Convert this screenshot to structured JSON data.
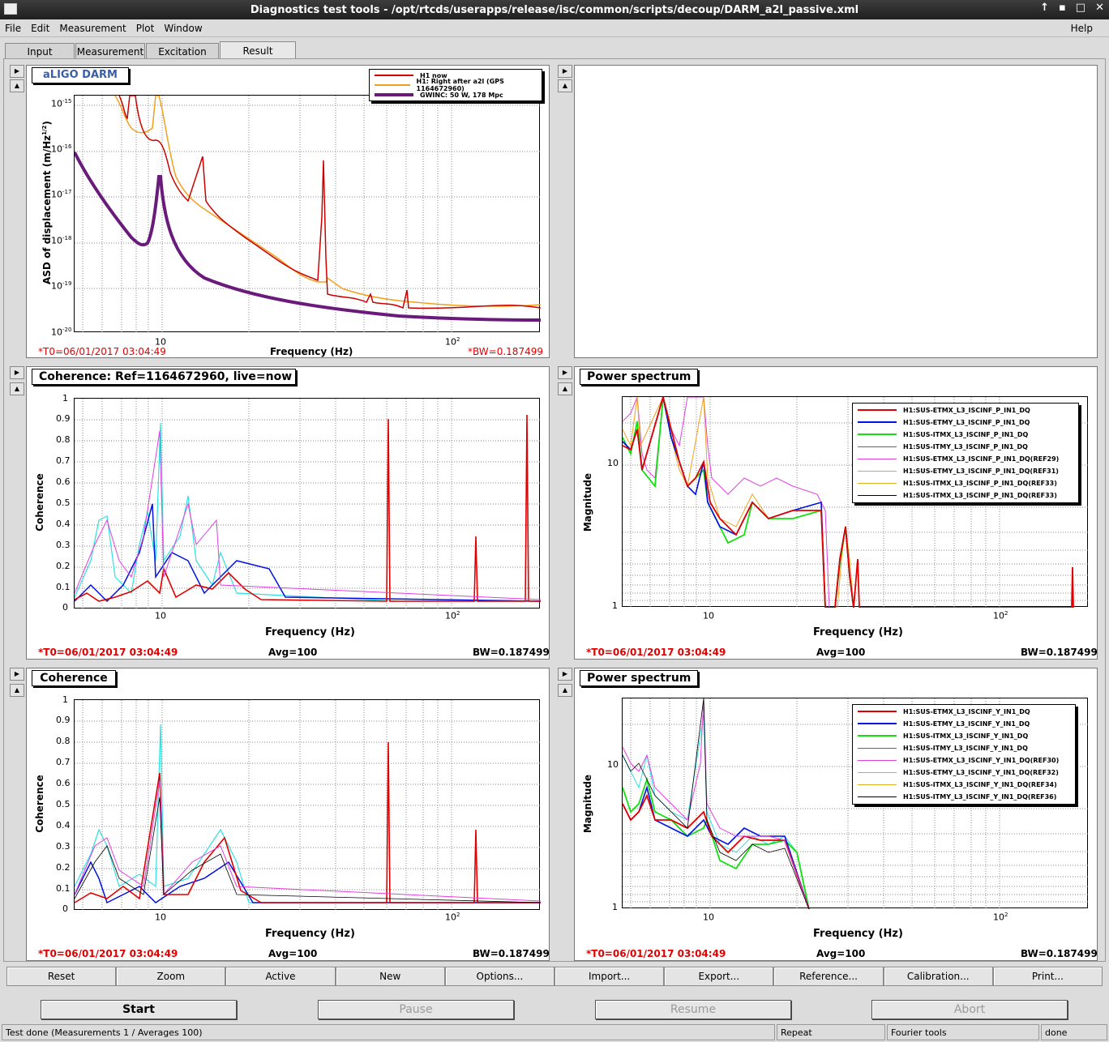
{
  "window": {
    "title": "Diagnostics test tools - /opt/rtcds/userapps/release/isc/common/scripts/decoup/DARM_a2l_passive.xml"
  },
  "menu": {
    "file": "File",
    "edit": "Edit",
    "measurement": "Measurement",
    "plot": "Plot",
    "window": "Window",
    "help": "Help"
  },
  "tabs": [
    "Input",
    "Measurement",
    "Excitation",
    "Result"
  ],
  "panels": {
    "darm": {
      "title": "aLIGO DARM",
      "ylabel": "ASD of displacement (m/Hz",
      "ylabel_sup": "1/2",
      "ylabel_end": ")",
      "xlabel": "Frequency (Hz)",
      "t0": "*T0=06/01/2017 03:04:49",
      "bw": "*BW=0.187499",
      "yticks": [
        {
          "base": "10",
          "exp": "-15"
        },
        {
          "base": "10",
          "exp": "-16"
        },
        {
          "base": "10",
          "exp": "-17"
        },
        {
          "base": "10",
          "exp": "-18"
        },
        {
          "base": "10",
          "exp": "-19"
        },
        {
          "base": "10",
          "exp": "-20"
        }
      ],
      "xticks": [
        {
          "base": "10",
          "exp": ""
        },
        {
          "base": "10",
          "exp": "2"
        }
      ],
      "legend": [
        {
          "label": "H1 now",
          "color": "#d40000"
        },
        {
          "label": "H1: Right after a2l (GPS 1164672960)",
          "color": "#f0a020"
        },
        {
          "label": "GWINC: 50 W, 178 Mpc",
          "color": "#6a1a7a"
        }
      ]
    },
    "coh1": {
      "title": "Coherence: Ref=1164672960, live=now",
      "ylabel": "Coherence",
      "xlabel": "Frequency (Hz)",
      "t0": "*T0=06/01/2017 03:04:49",
      "avg": "Avg=100",
      "bw": "BW=0.187499",
      "yticks": [
        "1",
        "0.9",
        "0.8",
        "0.7",
        "0.6",
        "0.5",
        "0.4",
        "0.3",
        "0.2",
        "0.1",
        "0"
      ],
      "xticks": [
        {
          "base": "10",
          "exp": ""
        },
        {
          "base": "10",
          "exp": "2"
        }
      ]
    },
    "ps1": {
      "title": "Power spectrum",
      "ylabel": "Magnitude",
      "xlabel": "Frequency (Hz)",
      "t0": "*T0=06/01/2017 03:04:49",
      "avg": "Avg=100",
      "bw": "BW=0.187499",
      "yticks": [
        "10",
        "1"
      ],
      "xticks": [
        {
          "base": "10",
          "exp": ""
        },
        {
          "base": "10",
          "exp": "2"
        }
      ],
      "legend": [
        {
          "label": "H1:SUS-ETMX_L3_ISCINF_P_IN1_DQ",
          "color": "#e00000"
        },
        {
          "label": "H1:SUS-ETMY_L3_ISCINF_P_IN1_DQ",
          "color": "#0010e0"
        },
        {
          "label": "H1:SUS-ITMX_L3_ISCINF_P_IN1_DQ",
          "color": "#10e010"
        },
        {
          "label": "H1:SUS-ITMY_L3_ISCINF_P_IN1_DQ",
          "color": "#8a5a30"
        },
        {
          "label": "H1:SUS-ETMX_L3_ISCINF_P_IN1_DQ(REF29)",
          "color": "#e040e0"
        },
        {
          "label": "H1:SUS-ETMY_L3_ISCINF_P_IN1_DQ(REF31)",
          "color": "#30e0e0"
        },
        {
          "label": "H1:SUS-ITMX_L3_ISCINF_P_IN1_DQ(REF33)",
          "color": "#e0b020"
        },
        {
          "label": "H1:SUS-ITMX_L3_ISCINF_P_IN1_DQ(REF33)",
          "color": "#000000"
        }
      ]
    },
    "coh2": {
      "title": "Coherence",
      "ylabel": "Coherence",
      "xlabel": "Frequency (Hz)",
      "t0": "*T0=06/01/2017 03:04:49",
      "avg": "Avg=100",
      "bw": "BW=0.187499",
      "yticks": [
        "1",
        "0.9",
        "0.8",
        "0.7",
        "0.6",
        "0.5",
        "0.4",
        "0.3",
        "0.2",
        "0.1",
        "0"
      ],
      "xticks": [
        {
          "base": "10",
          "exp": ""
        },
        {
          "base": "10",
          "exp": "2"
        }
      ]
    },
    "ps2": {
      "title": "Power spectrum",
      "ylabel": "Magnitude",
      "xlabel": "Frequency (Hz)",
      "t0": "*T0=06/01/2017 03:04:49",
      "avg": "Avg=100",
      "bw": "BW=0.187499",
      "yticks": [
        "10",
        "1"
      ],
      "xticks": [
        {
          "base": "10",
          "exp": ""
        },
        {
          "base": "10",
          "exp": "2"
        }
      ],
      "legend": [
        {
          "label": "H1:SUS-ETMX_L3_ISCINF_Y_IN1_DQ",
          "color": "#e00000"
        },
        {
          "label": "H1:SUS-ETMY_L3_ISCINF_Y_IN1_DQ",
          "color": "#0010e0"
        },
        {
          "label": "H1:SUS-ITMX_L3_ISCINF_Y_IN1_DQ",
          "color": "#10e010"
        },
        {
          "label": "H1:SUS-ITMY_L3_ISCINF_Y_IN1_DQ",
          "color": "#8a5a30"
        },
        {
          "label": "H1:SUS-ETMX_L3_ISCINF_Y_IN1_DQ(REF30)",
          "color": "#e040e0"
        },
        {
          "label": "H1:SUS-ETMY_L3_ISCINF_Y_IN1_DQ(REF32)",
          "color": "#30e0e0"
        },
        {
          "label": "H1:SUS-ITMX_L3_ISCINF_Y_IN1_DQ(REF34)",
          "color": "#e0b020"
        },
        {
          "label": "H1:SUS-ITMY_L3_ISCINF_Y_IN1_DQ(REF36)",
          "color": "#000000"
        }
      ]
    }
  },
  "toolbar": [
    "Reset",
    "Zoom",
    "Active",
    "New",
    "Options...",
    "Import...",
    "Export...",
    "Reference...",
    "Calibration...",
    "Print..."
  ],
  "controls": {
    "start": "Start",
    "pause": "Pause",
    "resume": "Resume",
    "abort": "Abort"
  },
  "status": {
    "main": "Test done (Measurements 1 / Averages 100)",
    "mode": "Repeat",
    "tools": "Fourier tools",
    "state": "done"
  }
}
